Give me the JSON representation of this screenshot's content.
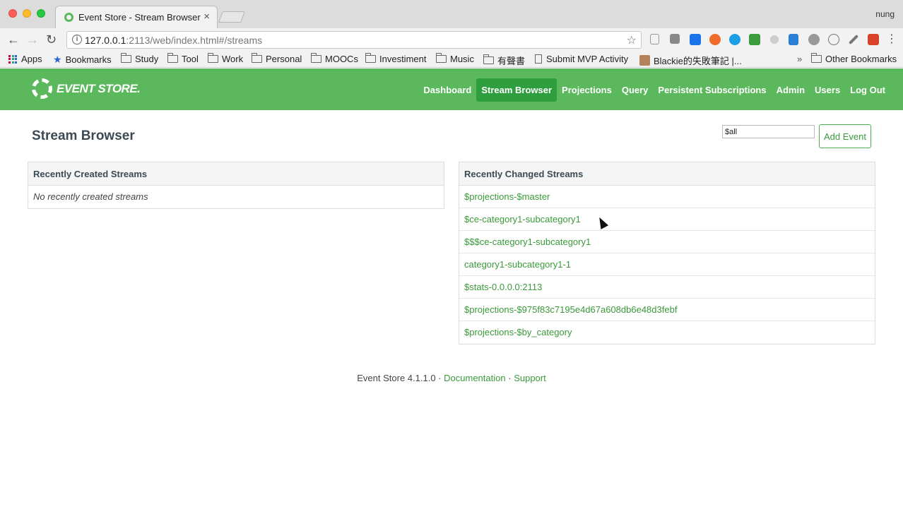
{
  "browser": {
    "tab_title": "Event Store - Stream Browser",
    "tab_close": "×",
    "profile_name": "nung",
    "url_host": "127.0.0.1",
    "url_rest": ":2113/web/index.html#/streams",
    "bookmarks": [
      {
        "label": "Apps",
        "icon": "apps-grid-icon"
      },
      {
        "label": "Bookmarks",
        "icon": "star-icon"
      },
      {
        "label": "Study",
        "icon": "folder-icon"
      },
      {
        "label": "Tool",
        "icon": "folder-icon"
      },
      {
        "label": "Work",
        "icon": "folder-icon"
      },
      {
        "label": "Personal",
        "icon": "folder-icon"
      },
      {
        "label": "MOOCs",
        "icon": "folder-icon"
      },
      {
        "label": "Investiment",
        "icon": "folder-icon"
      },
      {
        "label": "Music",
        "icon": "folder-icon"
      },
      {
        "label": "有聲書",
        "icon": "folder-icon"
      },
      {
        "label": "Submit MVP Activity",
        "icon": "page-icon"
      },
      {
        "label": "Blackie的失敗筆記 |...",
        "icon": "avatar-icon"
      }
    ],
    "overflow": "»",
    "other_bookmarks": "Other Bookmarks"
  },
  "app": {
    "logo_text": "EVENT STORE.",
    "nav": [
      {
        "label": "Dashboard",
        "active": false
      },
      {
        "label": "Stream Browser",
        "active": true
      },
      {
        "label": "Projections",
        "active": false
      },
      {
        "label": "Query",
        "active": false
      },
      {
        "label": "Persistent Subscriptions",
        "active": false
      },
      {
        "label": "Admin",
        "active": false
      },
      {
        "label": "Users",
        "active": false
      },
      {
        "label": "Log Out",
        "active": false
      }
    ],
    "page_title": "Stream Browser",
    "stream_input_value": "$all",
    "add_event_label": "Add Event",
    "recently_created": {
      "title": "Recently Created Streams",
      "empty_text": "No recently created streams"
    },
    "recently_changed": {
      "title": "Recently Changed Streams",
      "streams": [
        "$projections-$master",
        "$ce-category1-subcategory1",
        "$$$ce-category1-subcategory1",
        "category1-subcategory1-1",
        "$stats-0.0.0.0:2113",
        "$projections-$975f83c7195e4d67a608db6e48d3febf",
        "$projections-$by_category"
      ]
    },
    "footer": {
      "version": "Event Store 4.1.1.0",
      "sep": "·",
      "documentation": "Documentation",
      "support": "Support"
    }
  },
  "colors": {
    "brand_green": "#5cb85c",
    "nav_active": "#2f9e3f",
    "link_green": "#3a9a3a"
  }
}
